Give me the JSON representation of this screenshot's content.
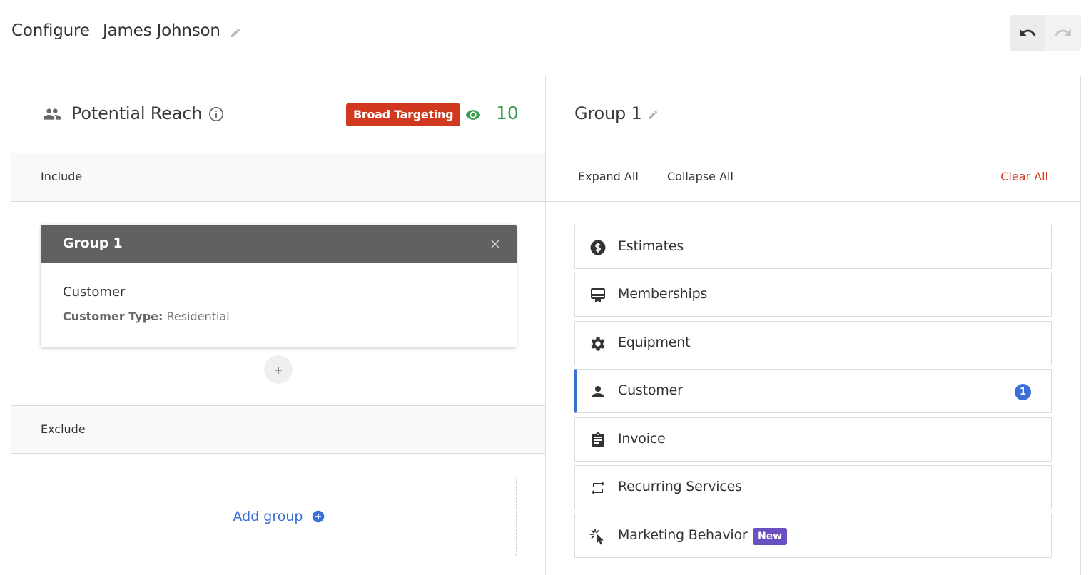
{
  "header": {
    "configure_label": "Configure",
    "audience_name": "James Johnson"
  },
  "reach": {
    "title": "Potential Reach",
    "badge": "Broad Targeting",
    "count": "10"
  },
  "include": {
    "label": "Include",
    "group": {
      "title": "Group 1",
      "criterion": "Customer",
      "detail_key": "Customer Type:",
      "detail_value": "Residential"
    },
    "add_symbol": "+"
  },
  "exclude": {
    "label": "Exclude",
    "add_group_label": "Add group"
  },
  "editor": {
    "title": "Group 1",
    "expand_all": "Expand All",
    "collapse_all": "Collapse All",
    "clear_all": "Clear All"
  },
  "categories": [
    {
      "label": "Estimates",
      "icon": "dollar-circle-icon"
    },
    {
      "label": "Memberships",
      "icon": "membership-card-icon"
    },
    {
      "label": "Equipment",
      "icon": "gear-icon"
    },
    {
      "label": "Customer",
      "icon": "person-icon",
      "badge": "1",
      "active": true
    },
    {
      "label": "Invoice",
      "icon": "clipboard-icon"
    },
    {
      "label": "Recurring Services",
      "icon": "repeat-icon"
    },
    {
      "label": "Marketing Behavior",
      "icon": "click-cursor-icon",
      "tag": "New"
    }
  ],
  "colors": {
    "accent_blue": "#3a6fd8",
    "danger_red": "#d0391f",
    "success_green": "#3a9d4e",
    "new_purple": "#6a4fc0",
    "group_header": "#616161"
  }
}
